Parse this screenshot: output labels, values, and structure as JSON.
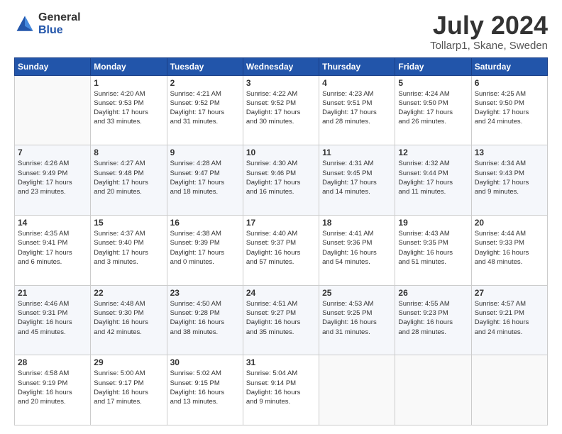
{
  "header": {
    "logo_line1": "General",
    "logo_line2": "Blue",
    "title": "July 2024",
    "subtitle": "Tollarp1, Skane, Sweden"
  },
  "days_of_week": [
    "Sunday",
    "Monday",
    "Tuesday",
    "Wednesday",
    "Thursday",
    "Friday",
    "Saturday"
  ],
  "weeks": [
    [
      {
        "day": "",
        "info": ""
      },
      {
        "day": "1",
        "info": "Sunrise: 4:20 AM\nSunset: 9:53 PM\nDaylight: 17 hours\nand 33 minutes."
      },
      {
        "day": "2",
        "info": "Sunrise: 4:21 AM\nSunset: 9:52 PM\nDaylight: 17 hours\nand 31 minutes."
      },
      {
        "day": "3",
        "info": "Sunrise: 4:22 AM\nSunset: 9:52 PM\nDaylight: 17 hours\nand 30 minutes."
      },
      {
        "day": "4",
        "info": "Sunrise: 4:23 AM\nSunset: 9:51 PM\nDaylight: 17 hours\nand 28 minutes."
      },
      {
        "day": "5",
        "info": "Sunrise: 4:24 AM\nSunset: 9:50 PM\nDaylight: 17 hours\nand 26 minutes."
      },
      {
        "day": "6",
        "info": "Sunrise: 4:25 AM\nSunset: 9:50 PM\nDaylight: 17 hours\nand 24 minutes."
      }
    ],
    [
      {
        "day": "7",
        "info": "Sunrise: 4:26 AM\nSunset: 9:49 PM\nDaylight: 17 hours\nand 23 minutes."
      },
      {
        "day": "8",
        "info": "Sunrise: 4:27 AM\nSunset: 9:48 PM\nDaylight: 17 hours\nand 20 minutes."
      },
      {
        "day": "9",
        "info": "Sunrise: 4:28 AM\nSunset: 9:47 PM\nDaylight: 17 hours\nand 18 minutes."
      },
      {
        "day": "10",
        "info": "Sunrise: 4:30 AM\nSunset: 9:46 PM\nDaylight: 17 hours\nand 16 minutes."
      },
      {
        "day": "11",
        "info": "Sunrise: 4:31 AM\nSunset: 9:45 PM\nDaylight: 17 hours\nand 14 minutes."
      },
      {
        "day": "12",
        "info": "Sunrise: 4:32 AM\nSunset: 9:44 PM\nDaylight: 17 hours\nand 11 minutes."
      },
      {
        "day": "13",
        "info": "Sunrise: 4:34 AM\nSunset: 9:43 PM\nDaylight: 17 hours\nand 9 minutes."
      }
    ],
    [
      {
        "day": "14",
        "info": "Sunrise: 4:35 AM\nSunset: 9:41 PM\nDaylight: 17 hours\nand 6 minutes."
      },
      {
        "day": "15",
        "info": "Sunrise: 4:37 AM\nSunset: 9:40 PM\nDaylight: 17 hours\nand 3 minutes."
      },
      {
        "day": "16",
        "info": "Sunrise: 4:38 AM\nSunset: 9:39 PM\nDaylight: 17 hours\nand 0 minutes."
      },
      {
        "day": "17",
        "info": "Sunrise: 4:40 AM\nSunset: 9:37 PM\nDaylight: 16 hours\nand 57 minutes."
      },
      {
        "day": "18",
        "info": "Sunrise: 4:41 AM\nSunset: 9:36 PM\nDaylight: 16 hours\nand 54 minutes."
      },
      {
        "day": "19",
        "info": "Sunrise: 4:43 AM\nSunset: 9:35 PM\nDaylight: 16 hours\nand 51 minutes."
      },
      {
        "day": "20",
        "info": "Sunrise: 4:44 AM\nSunset: 9:33 PM\nDaylight: 16 hours\nand 48 minutes."
      }
    ],
    [
      {
        "day": "21",
        "info": "Sunrise: 4:46 AM\nSunset: 9:31 PM\nDaylight: 16 hours\nand 45 minutes."
      },
      {
        "day": "22",
        "info": "Sunrise: 4:48 AM\nSunset: 9:30 PM\nDaylight: 16 hours\nand 42 minutes."
      },
      {
        "day": "23",
        "info": "Sunrise: 4:50 AM\nSunset: 9:28 PM\nDaylight: 16 hours\nand 38 minutes."
      },
      {
        "day": "24",
        "info": "Sunrise: 4:51 AM\nSunset: 9:27 PM\nDaylight: 16 hours\nand 35 minutes."
      },
      {
        "day": "25",
        "info": "Sunrise: 4:53 AM\nSunset: 9:25 PM\nDaylight: 16 hours\nand 31 minutes."
      },
      {
        "day": "26",
        "info": "Sunrise: 4:55 AM\nSunset: 9:23 PM\nDaylight: 16 hours\nand 28 minutes."
      },
      {
        "day": "27",
        "info": "Sunrise: 4:57 AM\nSunset: 9:21 PM\nDaylight: 16 hours\nand 24 minutes."
      }
    ],
    [
      {
        "day": "28",
        "info": "Sunrise: 4:58 AM\nSunset: 9:19 PM\nDaylight: 16 hours\nand 20 minutes."
      },
      {
        "day": "29",
        "info": "Sunrise: 5:00 AM\nSunset: 9:17 PM\nDaylight: 16 hours\nand 17 minutes."
      },
      {
        "day": "30",
        "info": "Sunrise: 5:02 AM\nSunset: 9:15 PM\nDaylight: 16 hours\nand 13 minutes."
      },
      {
        "day": "31",
        "info": "Sunrise: 5:04 AM\nSunset: 9:14 PM\nDaylight: 16 hours\nand 9 minutes."
      },
      {
        "day": "",
        "info": ""
      },
      {
        "day": "",
        "info": ""
      },
      {
        "day": "",
        "info": ""
      }
    ]
  ]
}
